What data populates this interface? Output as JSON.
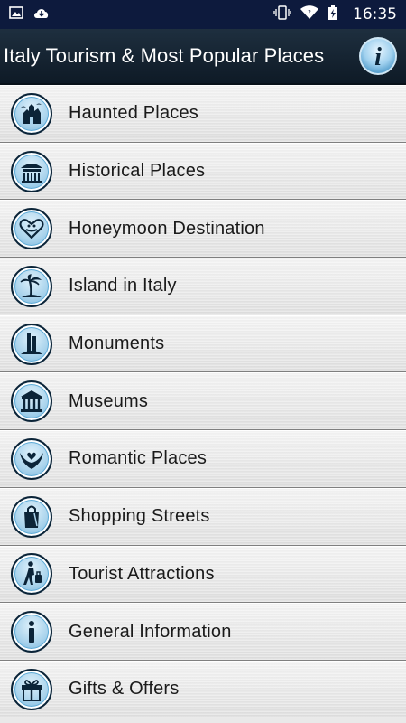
{
  "status_bar": {
    "time": "16:35"
  },
  "app_bar": {
    "title": "Italy Tourism & Most Popular Places",
    "info_icon": "info-icon"
  },
  "menu": [
    {
      "label": "Haunted Places",
      "icon": "haunted-house-icon"
    },
    {
      "label": "Historical Places",
      "icon": "historical-temple-icon"
    },
    {
      "label": "Honeymoon Destination",
      "icon": "honeymoon-heart-icon"
    },
    {
      "label": "Island in Italy",
      "icon": "palm-island-icon"
    },
    {
      "label": "Monuments",
      "icon": "monument-icon"
    },
    {
      "label": "Museums",
      "icon": "museum-icon"
    },
    {
      "label": "Romantic Places",
      "icon": "romantic-hands-heart-icon"
    },
    {
      "label": "Shopping Streets",
      "icon": "shopping-bag-icon"
    },
    {
      "label": "Tourist Attractions",
      "icon": "traveler-luggage-icon"
    },
    {
      "label": "General Information",
      "icon": "info-icon"
    },
    {
      "label": "Gifts & Offers",
      "icon": "gift-icon"
    }
  ],
  "colors": {
    "status_bar": "#0d1a3d",
    "app_bar": "#16232f",
    "icon_dark": "#0b2438",
    "icon_light": "#a9d3ec"
  }
}
